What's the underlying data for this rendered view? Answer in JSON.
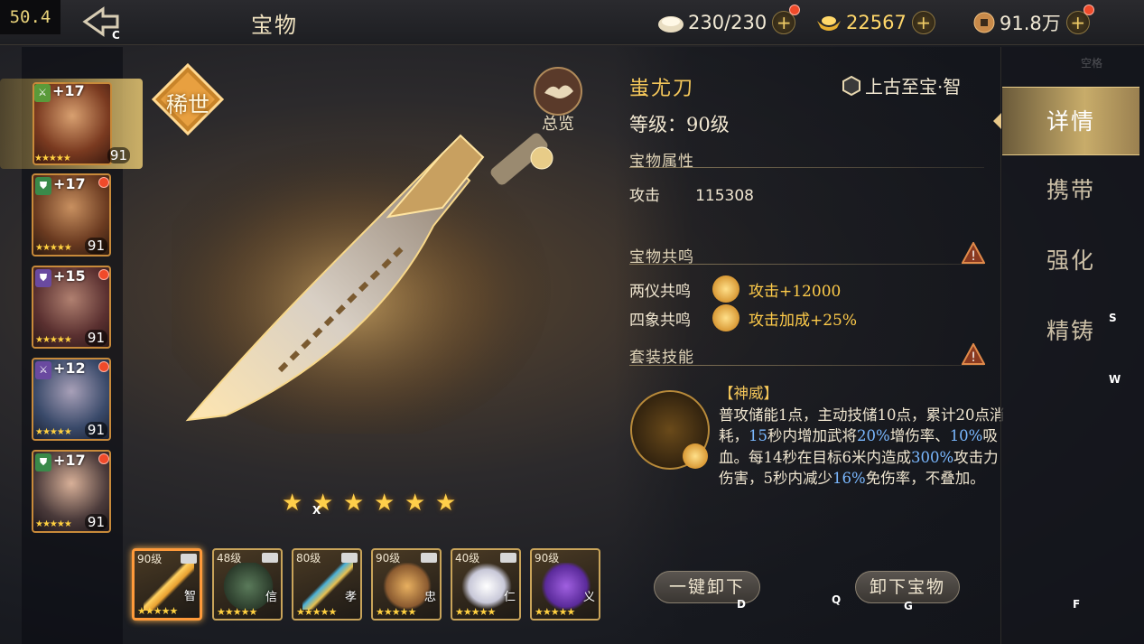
{
  "fps": "50.4",
  "header": {
    "title": "宝物",
    "back_key": "C",
    "resources": [
      {
        "icon": "bun-icon",
        "value": "230/230"
      },
      {
        "icon": "gold-ingot-icon",
        "value": "22567"
      },
      {
        "icon": "copper-coin-icon",
        "value": "91.8万"
      }
    ],
    "plus": "+"
  },
  "hotkeys": {
    "space": "空格",
    "back": "C",
    "stars": "X",
    "unequip_all": "D",
    "q": "Q",
    "unequip": "G",
    "f": "F",
    "s": "S",
    "w": "W"
  },
  "heroes": [
    {
      "plus": "+17",
      "level": "91",
      "stars": "★★★★★",
      "badge": "sword",
      "selected": true
    },
    {
      "plus": "+17",
      "level": "91",
      "stars": "★★★★★",
      "badge": "shield"
    },
    {
      "plus": "+15",
      "level": "91",
      "stars": "★★★★★",
      "badge": "shield-purple"
    },
    {
      "plus": "+12",
      "level": "91",
      "stars": "★★★★★",
      "badge": "sword"
    },
    {
      "plus": "+17",
      "level": "91",
      "stars": "★★★★★",
      "badge": "shield"
    }
  ],
  "rarity_badge": "稀世",
  "overview_label": "总览",
  "treasure_stars": 6,
  "treasure_cards": [
    {
      "level": "90级",
      "virtue": "智",
      "selected": true
    },
    {
      "level": "48级",
      "virtue": "信"
    },
    {
      "level": "80级",
      "virtue": "孝"
    },
    {
      "level": "90级",
      "virtue": "忠"
    },
    {
      "level": "40级",
      "virtue": "仁"
    },
    {
      "level": "90级",
      "virtue": "义"
    }
  ],
  "card_stars": "★★★★★",
  "info": {
    "name": "蚩尤刀",
    "grade": "上古至宝·智",
    "level": "等级：90级",
    "attr_title": "宝物属性",
    "attack_label": "攻击",
    "attack_value": "115308",
    "resonance_title": "宝物共鸣",
    "resonance": [
      {
        "label": "两仪共鸣",
        "effect": "攻击+12000"
      },
      {
        "label": "四象共鸣",
        "effect": "攻击加成+25%"
      }
    ],
    "set_skill_title": "套装技能",
    "skill_name": "【神威】",
    "skill_t1": "普攻储能1点，主动技储10点，累计20点消耗，",
    "skill_h1": "15",
    "skill_t2": "秒内增加武将",
    "skill_h2": "20%",
    "skill_t3": "增伤率、",
    "skill_h3": "10%",
    "skill_t4": "吸血。每14秒在目标6米内造成",
    "skill_h4": "300%",
    "skill_t5": "攻击力伤害，5秒内减少",
    "skill_h5": "16%",
    "skill_t6": "免伤率，不叠加。"
  },
  "buttons": {
    "unequip_all": "一键卸下",
    "unequip": "卸下宝物"
  },
  "tabs": [
    "详情",
    "携带",
    "强化",
    "精铸"
  ],
  "colors": {
    "accent": "#f5c75a",
    "highlight": "#7ab8ff",
    "alert": "#f04a2a"
  }
}
